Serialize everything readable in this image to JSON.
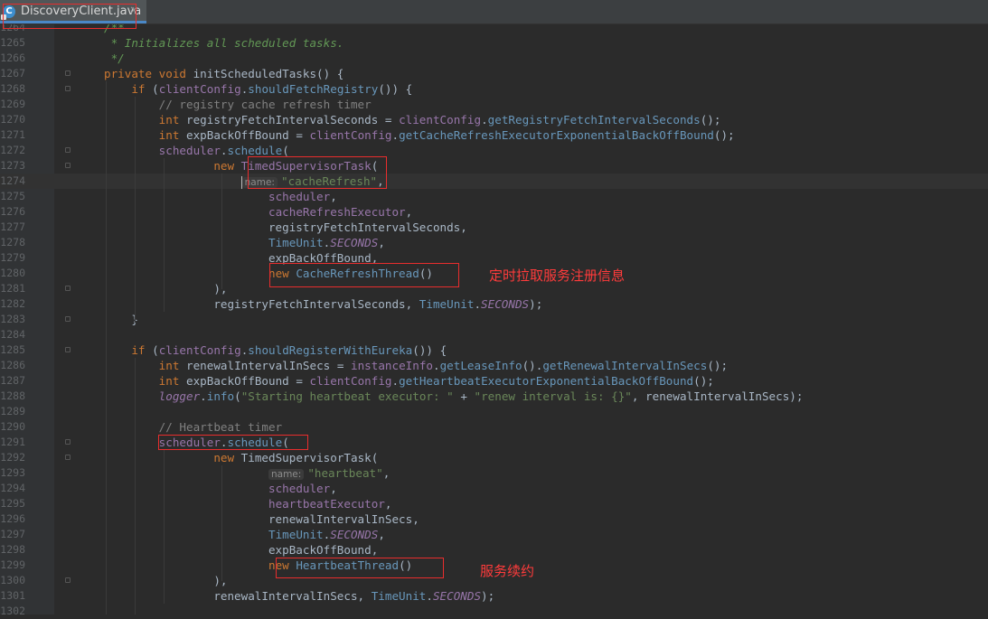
{
  "tab": {
    "filename": "DiscoveryClient.java",
    "close_glyph": "×",
    "icon": "java-class-icon"
  },
  "annotations": {
    "note1": "定时拉取服务注册信息",
    "note2": "服务续约"
  },
  "code": [
    {
      "n": "1264",
      "t": [
        [
          "doc",
          "/**"
        ]
      ]
    },
    {
      "n": "1265",
      "t": [
        [
          "doc",
          " * Initializes all scheduled tasks."
        ]
      ]
    },
    {
      "n": "1266",
      "t": [
        [
          "doc",
          " */"
        ]
      ]
    },
    {
      "n": "1267",
      "t": [
        [
          "kw",
          "private void "
        ],
        [
          "p",
          "initScheduledTasks() {"
        ]
      ]
    },
    {
      "n": "1268",
      "t": [
        [
          "p",
          "    "
        ],
        [
          "kw",
          "if "
        ],
        [
          "p",
          "("
        ],
        [
          "fld",
          "clientConfig"
        ],
        [
          "p",
          "."
        ],
        [
          "cls",
          "shouldFetchRegistry"
        ],
        [
          "p",
          "()) {"
        ]
      ]
    },
    {
      "n": "1269",
      "t": [
        [
          "cm",
          "        // registry cache refresh timer"
        ]
      ]
    },
    {
      "n": "1270",
      "t": [
        [
          "p",
          "        "
        ],
        [
          "kw",
          "int "
        ],
        [
          "p",
          "registryFetchIntervalSeconds = "
        ],
        [
          "fld",
          "clientConfig"
        ],
        [
          "p",
          "."
        ],
        [
          "cls",
          "getRegistryFetchIntervalSeconds"
        ],
        [
          "p",
          "();"
        ]
      ]
    },
    {
      "n": "1271",
      "t": [
        [
          "p",
          "        "
        ],
        [
          "kw",
          "int "
        ],
        [
          "p",
          "expBackOffBound = "
        ],
        [
          "fld",
          "clientConfig"
        ],
        [
          "p",
          "."
        ],
        [
          "cls",
          "getCacheRefreshExecutorExponentialBackOffBound"
        ],
        [
          "p",
          "();"
        ]
      ]
    },
    {
      "n": "1272",
      "t": [
        [
          "p",
          "        "
        ],
        [
          "fld",
          "scheduler"
        ],
        [
          "p",
          "."
        ],
        [
          "cls",
          "schedule"
        ],
        [
          "p",
          "("
        ]
      ]
    },
    {
      "n": "1273",
      "t": [
        [
          "p",
          "                "
        ],
        [
          "kw",
          "new "
        ],
        [
          "fld",
          "TimedSupervisorTask"
        ],
        [
          "p",
          "("
        ]
      ]
    },
    {
      "n": "1274",
      "t": [
        [
          "p",
          "                    "
        ],
        [
          "hint",
          "name:"
        ],
        [
          "str",
          "\"cacheRefresh\""
        ],
        [
          "p",
          ","
        ]
      ],
      "current": true
    },
    {
      "n": "1275",
      "t": [
        [
          "p",
          "                        "
        ],
        [
          "fld",
          "scheduler"
        ],
        [
          "p",
          ","
        ]
      ]
    },
    {
      "n": "1276",
      "t": [
        [
          "p",
          "                        "
        ],
        [
          "fld",
          "cacheRefreshExecutor"
        ],
        [
          "p",
          ","
        ]
      ]
    },
    {
      "n": "1277",
      "t": [
        [
          "p",
          "                        registryFetchIntervalSeconds,"
        ]
      ]
    },
    {
      "n": "1278",
      "t": [
        [
          "p",
          "                        "
        ],
        [
          "cls",
          "TimeUnit"
        ],
        [
          "p",
          "."
        ],
        [
          "st",
          "SECONDS"
        ],
        [
          "p",
          ","
        ]
      ]
    },
    {
      "n": "1279",
      "t": [
        [
          "p",
          "                        expBackOffBound,"
        ]
      ]
    },
    {
      "n": "1280",
      "t": [
        [
          "p",
          "                        "
        ],
        [
          "kw",
          "new "
        ],
        [
          "cls",
          "CacheRefreshThread"
        ],
        [
          "p",
          "()"
        ]
      ]
    },
    {
      "n": "1281",
      "t": [
        [
          "p",
          "                ),"
        ]
      ]
    },
    {
      "n": "1282",
      "t": [
        [
          "p",
          "                registryFetchIntervalSeconds, "
        ],
        [
          "cls",
          "TimeUnit"
        ],
        [
          "p",
          "."
        ],
        [
          "st",
          "SECONDS"
        ],
        [
          "p",
          ");"
        ]
      ]
    },
    {
      "n": "1283",
      "t": [
        [
          "p",
          "    }"
        ]
      ]
    },
    {
      "n": "1284",
      "t": [
        [
          "p",
          ""
        ]
      ]
    },
    {
      "n": "1285",
      "t": [
        [
          "p",
          "    "
        ],
        [
          "kw",
          "if "
        ],
        [
          "p",
          "("
        ],
        [
          "fld",
          "clientConfig"
        ],
        [
          "p",
          "."
        ],
        [
          "cls",
          "shouldRegisterWithEureka"
        ],
        [
          "p",
          "()) {"
        ]
      ]
    },
    {
      "n": "1286",
      "t": [
        [
          "p",
          "        "
        ],
        [
          "kw",
          "int "
        ],
        [
          "p",
          "renewalIntervalInSecs = "
        ],
        [
          "fld",
          "instanceInfo"
        ],
        [
          "p",
          "."
        ],
        [
          "cls",
          "getLeaseInfo"
        ],
        [
          "p",
          "()."
        ],
        [
          "cls",
          "getRenewalIntervalInSecs"
        ],
        [
          "p",
          "();"
        ]
      ]
    },
    {
      "n": "1287",
      "t": [
        [
          "p",
          "        "
        ],
        [
          "kw",
          "int "
        ],
        [
          "p",
          "expBackOffBound = "
        ],
        [
          "fld",
          "clientConfig"
        ],
        [
          "p",
          "."
        ],
        [
          "cls",
          "getHeartbeatExecutorExponentialBackOffBound"
        ],
        [
          "p",
          "();"
        ]
      ]
    },
    {
      "n": "1288",
      "t": [
        [
          "p",
          "        "
        ],
        [
          "st",
          "logger"
        ],
        [
          "p",
          "."
        ],
        [
          "cls",
          "info"
        ],
        [
          "p",
          "("
        ],
        [
          "str",
          "\"Starting heartbeat executor: \""
        ],
        [
          "p",
          " + "
        ],
        [
          "str",
          "\"renew interval is: {}\""
        ],
        [
          "p",
          ", renewalIntervalInSecs);"
        ]
      ]
    },
    {
      "n": "1289",
      "t": [
        [
          "p",
          ""
        ]
      ]
    },
    {
      "n": "1290",
      "t": [
        [
          "cm",
          "        // Heartbeat timer"
        ]
      ]
    },
    {
      "n": "1291",
      "t": [
        [
          "p",
          "        "
        ],
        [
          "fld",
          "scheduler"
        ],
        [
          "p",
          "."
        ],
        [
          "cls",
          "schedule"
        ],
        [
          "p",
          "("
        ]
      ]
    },
    {
      "n": "1292",
      "t": [
        [
          "p",
          "                "
        ],
        [
          "kw",
          "new "
        ],
        [
          "p",
          "TimedSupervisorTask("
        ]
      ]
    },
    {
      "n": "1293",
      "t": [
        [
          "p",
          "                        "
        ],
        [
          "hint",
          "name:"
        ],
        [
          "str",
          "\"heartbeat\""
        ],
        [
          "p",
          ","
        ]
      ]
    },
    {
      "n": "1294",
      "t": [
        [
          "p",
          "                        "
        ],
        [
          "fld",
          "scheduler"
        ],
        [
          "p",
          ","
        ]
      ]
    },
    {
      "n": "1295",
      "t": [
        [
          "p",
          "                        "
        ],
        [
          "fld",
          "heartbeatExecutor"
        ],
        [
          "p",
          ","
        ]
      ]
    },
    {
      "n": "1296",
      "t": [
        [
          "p",
          "                        renewalIntervalInSecs,"
        ]
      ]
    },
    {
      "n": "1297",
      "t": [
        [
          "p",
          "                        "
        ],
        [
          "cls",
          "TimeUnit"
        ],
        [
          "p",
          "."
        ],
        [
          "st",
          "SECONDS"
        ],
        [
          "p",
          ","
        ]
      ]
    },
    {
      "n": "1298",
      "t": [
        [
          "p",
          "                        expBackOffBound,"
        ]
      ]
    },
    {
      "n": "1299",
      "t": [
        [
          "p",
          "                        "
        ],
        [
          "kw",
          "new "
        ],
        [
          "cls",
          "HeartbeatThread"
        ],
        [
          "p",
          "()"
        ]
      ]
    },
    {
      "n": "1300",
      "t": [
        [
          "p",
          "                ),"
        ]
      ]
    },
    {
      "n": "1301",
      "t": [
        [
          "p",
          "                renewalIntervalInSecs, "
        ],
        [
          "cls",
          "TimeUnit"
        ],
        [
          "p",
          "."
        ],
        [
          "st",
          "SECONDS"
        ],
        [
          "p",
          ");"
        ]
      ]
    },
    {
      "n": "1302",
      "t": [
        [
          "p",
          ""
        ]
      ]
    }
  ]
}
